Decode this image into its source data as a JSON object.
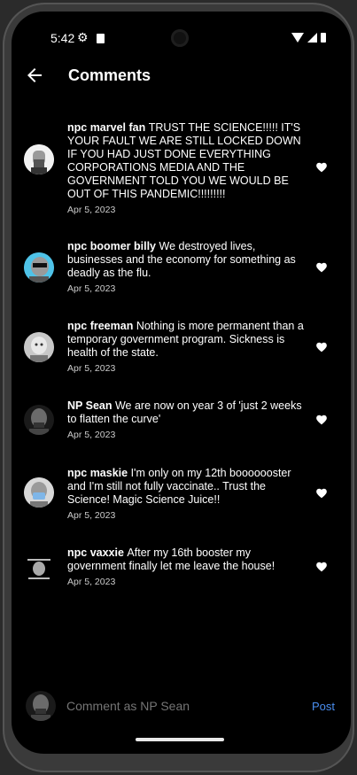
{
  "status": {
    "time": "5:42"
  },
  "header": {
    "title": "Comments",
    "back_icon": "arrow-left-icon"
  },
  "comments": [
    {
      "username": "npc marvel fan",
      "text": "TRUST THE SCIENCE!!!!! IT'S YOUR FAULT WE ARE STILL LOCKED DOWN IF YOU HAD JUST DONE EVERYTHING CORPORATIONS MEDIA AND THE GOVERNMENT TOLD YOU WE WOULD BE OUT OF THIS PANDEMIC!!!!!!!!!",
      "date": "Apr 5, 2023"
    },
    {
      "username": "npc boomer billy",
      "text": "We destroyed lives, businesses and the economy for something as deadly as the flu.",
      "date": "Apr 5, 2023"
    },
    {
      "username": "npc freeman",
      "text": "Nothing is more permanent than a temporary government program. Sickness is health of the state.",
      "date": "Apr 5, 2023"
    },
    {
      "username": "NP Sean",
      "text": "We are now on year 3 of 'just 2 weeks to flatten the curve'",
      "date": "Apr 5, 2023"
    },
    {
      "username": "npc maskie",
      "text": "I'm only on my 12th booooooster and I'm still not fully vaccinate.. Trust the Science! Magic Science Juice!!",
      "date": "Apr 5, 2023"
    },
    {
      "username": "npc vaxxie",
      "text": "After my 16th booster my government finally let me leave the house!",
      "date": "Apr 5, 2023"
    }
  ],
  "composer": {
    "placeholder": "Comment as NP Sean",
    "post_label": "Post"
  },
  "colors": {
    "background": "#000000",
    "accent": "#4a8ef0",
    "text": "#ffffff"
  }
}
